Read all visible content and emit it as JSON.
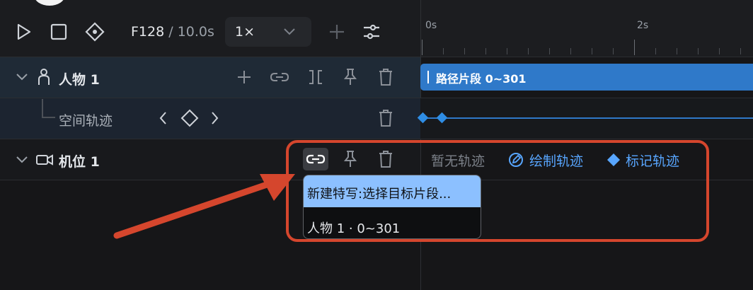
{
  "toolbar": {
    "play_icon": "play-icon",
    "stop_icon": "stop-icon",
    "keyframe_icon": "keyframe-diamond-icon",
    "frame_current": "F128",
    "frame_separator": " / ",
    "frame_total": "10.0s",
    "speed_value": "1×",
    "add_icon": "plus-icon",
    "settings_icon": "sliders-icon"
  },
  "ruler": {
    "labels": [
      "0s",
      "2s"
    ]
  },
  "tracks": {
    "person": {
      "name": "人物 1",
      "clip_label": "路径片段 0~301",
      "subtrack": "空间轨迹"
    },
    "camera": {
      "name": "机位 1",
      "empty_text": "暂无轨迹",
      "draw_action": "绘制轨迹",
      "mark_action": "标记轨迹"
    }
  },
  "tooltip": {
    "title": "新建特写:选择目标片段...",
    "option": "人物 1 · 0~301"
  },
  "colors": {
    "accent_blue": "#2f79c9",
    "link_blue": "#58a6ff",
    "annotation_red": "#d5462d",
    "tooltip_header": "#8cc0ff"
  }
}
